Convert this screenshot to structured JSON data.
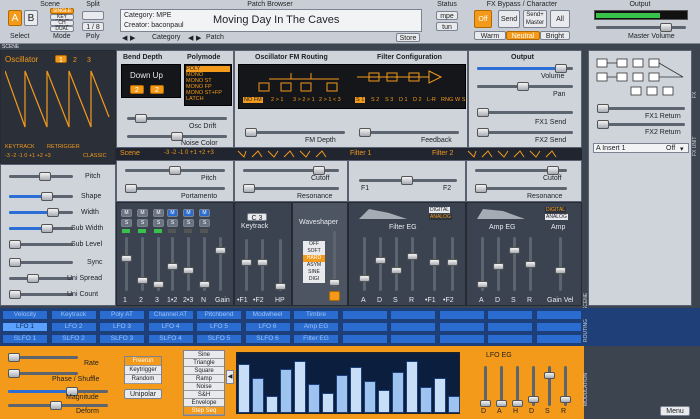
{
  "scene": {
    "title": "Scene",
    "buttons": [
      "A",
      "B"
    ],
    "active": "A",
    "select_label": "Select",
    "modes": [
      "SINGLE",
      "KEY SPLIT",
      "CH SPLIT",
      "DUAL"
    ],
    "mode_label": "Mode",
    "split_title": "Split",
    "split_value": "1 / 8",
    "poly_label": "Poly"
  },
  "patch": {
    "title": "Patch Browser",
    "category": "Category: MPE",
    "creator": "Creator: baconpaul",
    "name": "Moving Day In The Caves",
    "category_nav": "Category",
    "patch_nav": "Patch",
    "store": "Store",
    "arrow_left": "◀",
    "arrow_right": "▶"
  },
  "status": {
    "title": "Status",
    "mpe": "mpe",
    "tun": "tun"
  },
  "fx": {
    "title": "FX Bypass / Character",
    "buttons": [
      "Off",
      "Send",
      "Send+ Master",
      "All"
    ],
    "active": "Off",
    "characters": [
      "Warm",
      "Neutral",
      "Bright"
    ],
    "active_character": "Neutral"
  },
  "output": {
    "title": "Output",
    "master_volume": "Master Volume",
    "meter_level": 0.7
  },
  "oscillator": {
    "title": "Oscillator",
    "numbers": [
      "1",
      "2",
      "3"
    ],
    "active": "1",
    "keytrack": "KEYTRACK",
    "retrigger": "RETRIGGER",
    "octaves": "-3  -2  -1  0  +1  +2  +3",
    "type": "CLASSIC",
    "params": [
      "Pitch",
      "Shape",
      "Width",
      "Sub Width",
      "Sub Level",
      "Sync",
      "Uni Spread",
      "Uni Count"
    ]
  },
  "bend": {
    "title": "Bend Depth",
    "mode": "Down Up",
    "values": [
      "2",
      "2"
    ]
  },
  "polymode": {
    "title": "Polymode",
    "items": [
      "POLY",
      "MONO",
      "MONO ST",
      "MONO FP",
      "MONO ST+FP",
      "LATCH"
    ],
    "active": "POLY"
  },
  "osc_drift": "Osc Drift",
  "noise_color": "Noise Color",
  "fm_routing": {
    "title": "Oscillator FM Routing",
    "options": [
      "NO FM",
      "2 > 1",
      "3 > 2 > 1",
      "2 > 1 < 3",
      "2 > 1 < 3"
    ],
    "fm_depth": "FM Depth"
  },
  "filter_config": {
    "title": "Filter Configuration",
    "options": [
      "S 1",
      "S 2",
      "S 3",
      "D 1",
      "D 2",
      "L-R",
      "RNG",
      "W S"
    ],
    "feedback": "Feedback"
  },
  "out_section": {
    "title": "Output",
    "volume": "Volume",
    "pan": "Pan",
    "fx1_send": "FX1 Send",
    "fx2_send": "FX2 Send"
  },
  "scene_row": {
    "title": "Scene",
    "octaves": "-3  -2  -1  0  +1  +2  +3",
    "pitch": "Pitch",
    "portamento": "Portamento"
  },
  "filter1": {
    "title": "Filter 1",
    "cutoff": "Cutoff",
    "resonance": "Resonance"
  },
  "filter2": {
    "title": "Filter 2",
    "cutoff": "Cutoff",
    "resonance": "Resonance",
    "f1": "F1",
    "f2": "F2"
  },
  "mixer": {
    "labels": [
      "1",
      "2",
      "3",
      "1•2",
      "2•3",
      "N"
    ],
    "gain": "Gain",
    "osc": "OSC",
    "ring": "RING",
    "m": "M",
    "s": "S"
  },
  "keytrack": {
    "title": "Keytrack",
    "value": "C 3",
    "labels": [
      "•F1",
      "•F2",
      "HP"
    ]
  },
  "waveshaper": {
    "title": "Waveshaper",
    "items": [
      "OFF",
      "SOFT",
      "HARD",
      "ASYM",
      "SINE",
      "DIGI"
    ],
    "active": "HARD"
  },
  "filter_eg": {
    "title": "Filter EG",
    "digital": "DIGITAL",
    "analog": "ANALOG",
    "labels": [
      "A",
      "D",
      "S",
      "R",
      "•F1",
      "•F2"
    ]
  },
  "amp_eg": {
    "title": "Amp EG",
    "amp": "Amp",
    "digital": "DIGITAL",
    "analog": "ANALOG",
    "labels": [
      "A",
      "D",
      "S",
      "R",
      "Gain Vel"
    ]
  },
  "fx_right": {
    "fx1_return": "FX1 Return",
    "fx2_return": "FX2 Return",
    "insert": "A Insert 1",
    "insert_value": "Off"
  },
  "mod_row1": {
    "labels": [
      "Velocity",
      "Keytrack",
      "Poly AT",
      "Channel AT",
      "Pitchbend",
      "Modwheel",
      "Timbre",
      "",
      "",
      "",
      "",
      ""
    ]
  },
  "mod_row2": {
    "labels": [
      "LFO 1",
      "LFO 2",
      "LFO 3",
      "LFO 4",
      "LFO 5",
      "LFO 6",
      "Amp EG",
      "",
      "",
      "",
      "",
      ""
    ],
    "active": "LFO 1"
  },
  "mod_row3": {
    "labels": [
      "SLFO 1",
      "SLFO 2",
      "SLFO 3",
      "SLFO 4",
      "SLFO 5",
      "SLFO 6",
      "Filter EG",
      "",
      "",
      "",
      "",
      ""
    ]
  },
  "lfo": {
    "params": [
      "Rate",
      "Phase / Shuffle",
      "Magnitude",
      "Deform"
    ],
    "trigger": [
      "Freerun",
      "Keytrigger",
      "Random"
    ],
    "active_trigger": "Freerun",
    "unipolar": "Unipolar",
    "shapes": [
      "Sine",
      "Triangle",
      "Square",
      "Ramp",
      "Noise",
      "S&H",
      "Envelope",
      "Step Seq"
    ],
    "active_shape": "Step Seq",
    "eg_title": "LFO EG",
    "eg_labels": [
      "D",
      "A",
      "H",
      "D",
      "S",
      "R"
    ],
    "menu": "Menu"
  },
  "side_labels": {
    "scene": "SCENE",
    "global": "GLOBAL",
    "fx": "FX",
    "modulation": "MODULATION",
    "routing": "ROUTING",
    "fx_unit": "FX UNIT"
  },
  "colors": {
    "accent": "#f49a1a",
    "blue": "#2a6ccf",
    "panel": "#cfd4db",
    "dark": "#3b4350"
  }
}
